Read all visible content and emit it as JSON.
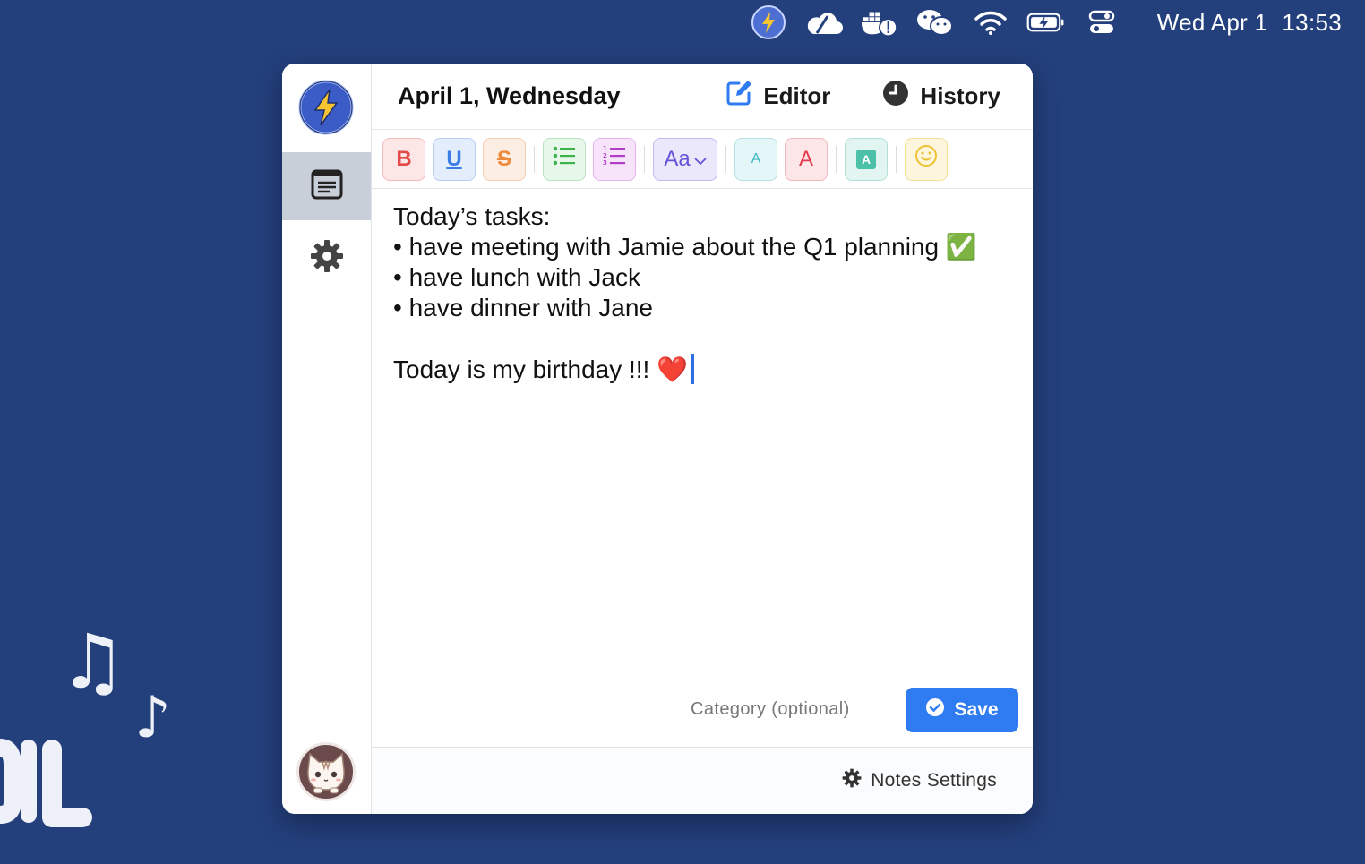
{
  "menubar": {
    "icons": [
      "app-bolt-icon",
      "cloud-icon",
      "docker-icon",
      "wechat-icon",
      "wifi-icon",
      "battery-charging-icon",
      "control-center-icon"
    ],
    "day": "Wed Apr 1",
    "time": "13:53"
  },
  "header": {
    "date": "April 1, Wednesday",
    "editor_label": "Editor",
    "history_label": "History"
  },
  "toolbar": {
    "bold": "B",
    "underline": "U",
    "strike": "S",
    "font_size": "Aa",
    "text_small": "A",
    "text_color": "A",
    "highlight": "A"
  },
  "editor": {
    "lines": [
      "Today’s tasks:",
      "• have meeting with Jamie about the Q1 planning ✅",
      "• have lunch with Jack",
      "• have dinner with Jane",
      "",
      "Today is my birthday !!! ❤️"
    ]
  },
  "form": {
    "category_placeholder": "Category (optional)",
    "save_label": "Save"
  },
  "footer": {
    "notes_settings_label": "Notes Settings"
  },
  "colors": {
    "desktop": "#233f7c",
    "accent": "#2f7bf1",
    "active_nav": "#c9cfd9"
  }
}
